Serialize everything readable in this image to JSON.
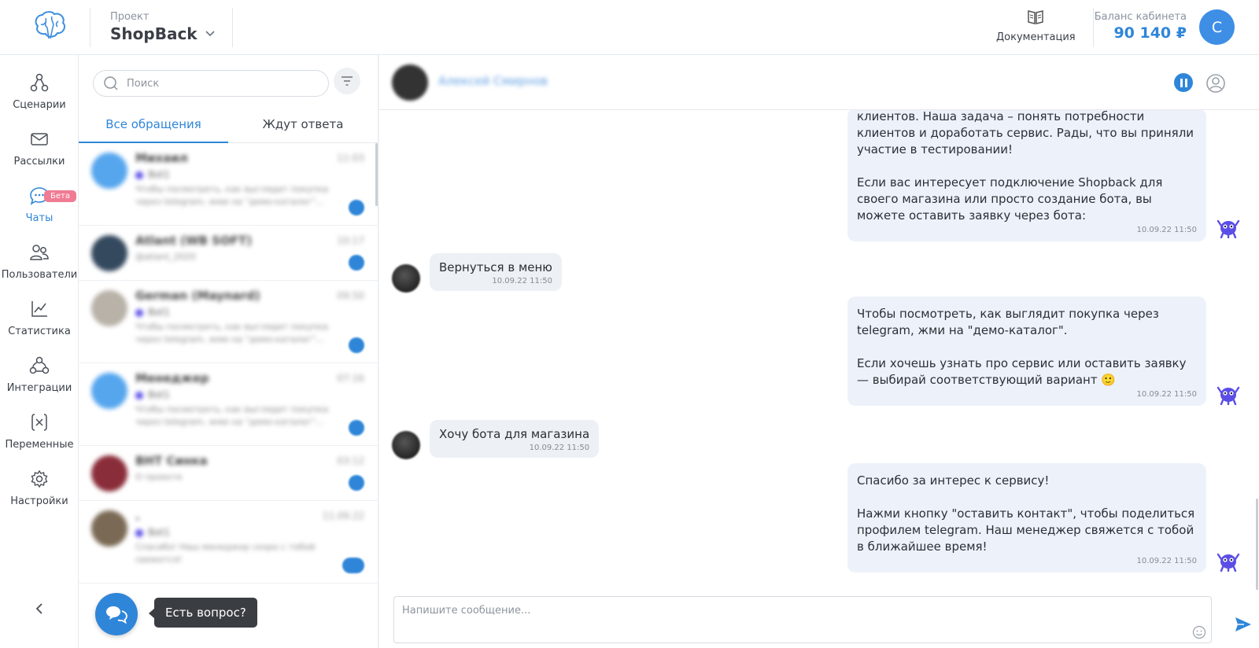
{
  "header": {
    "project_label": "Проект",
    "project_name": "ShopBack",
    "docs_label": "Документация",
    "balance_label": "Баланс кабинета",
    "balance_value": "90 140 ₽",
    "user_initial": "C"
  },
  "nav": {
    "items": [
      {
        "label": "Сценарии",
        "icon": "scenarios-icon"
      },
      {
        "label": "Рассылки",
        "icon": "mail-icon"
      },
      {
        "label": "Чаты",
        "icon": "chat-icon",
        "badge": "Бета",
        "active": true
      },
      {
        "label": "Пользователи",
        "icon": "users-icon"
      },
      {
        "label": "Статистика",
        "icon": "chart-icon"
      },
      {
        "label": "Интеграции",
        "icon": "integrations-icon"
      },
      {
        "label": "Переменные",
        "icon": "variables-icon"
      },
      {
        "label": "Настройки",
        "icon": "settings-icon"
      }
    ]
  },
  "list": {
    "search_placeholder": "Поиск",
    "tabs": [
      "Все обращения",
      "Ждут ответа"
    ],
    "chats": [
      {
        "name": "Михаил",
        "time": "11:03",
        "tag": "Bot1",
        "text": "Чтобы посмотреть, как выглядит покупка через telegram, жми на \"демо-каталог\"..."
      },
      {
        "name": "Atlant (WB SOFT)",
        "time": "10:17",
        "tag": "",
        "text": "@atlant_2020"
      },
      {
        "name": "German (Maynard)",
        "time": "09:50",
        "tag": "Bot1",
        "text": "Чтобы посмотреть, как выглядит покупка через telegram, жми на \"демо-каталог\"..."
      },
      {
        "name": "Менеджер",
        "time": "07:16",
        "tag": "Bot1",
        "text": "Чтобы посмотреть, как выглядит покупка через telegram, жми на \"демо-каталог\"..."
      },
      {
        "name": "BHT Синка",
        "time": "03:12",
        "tag": "",
        "text": "О проекте"
      },
      {
        "name": ".",
        "time": "11.09.22",
        "tag": "Bot1",
        "text": "Спасибо! Наш менеджер скоро с тобой свяжется!"
      }
    ]
  },
  "help": {
    "label": "Есть вопрос?"
  },
  "conversation": {
    "contact_name": "Алексей Смирнов",
    "composer_placeholder": "Напишите сообщение...",
    "messages": [
      {
        "dir": "out",
        "text": "клиентов. Наша задача – понять потребности клиентов и доработать сервис. Рады, что вы приняли участие в тестировании!\n\nЕсли вас интересует подключение Shopback для своего магазина или просто создание бота, вы можете оставить заявку через бота:",
        "time": "10.09.22 11:50"
      },
      {
        "dir": "in",
        "text": "Вернуться в меню",
        "time": "10.09.22 11:50"
      },
      {
        "dir": "out",
        "text": "Чтобы посмотреть, как выглядит покупка через telegram, жми на \"демо-каталог\".\n\nЕсли хочешь узнать про сервис или оставить заявку — выбирай соответствующий вариант 🙂",
        "time": "10.09.22 11:50"
      },
      {
        "dir": "in",
        "text": "Хочу бота для магазина",
        "time": "10.09.22 11:50"
      },
      {
        "dir": "out",
        "text": "Спасибо за интерес к сервису!\n\nНажми кнопку \"оставить контакт\", чтобы поделиться профилем telegram. Наш менеджер свяжется с тобой в ближайшее время!",
        "time": "10.09.22 11:50"
      }
    ]
  },
  "colors": {
    "accent": "#2f86d8",
    "beta": "#f07b93",
    "bot": "#5b4ee6"
  }
}
